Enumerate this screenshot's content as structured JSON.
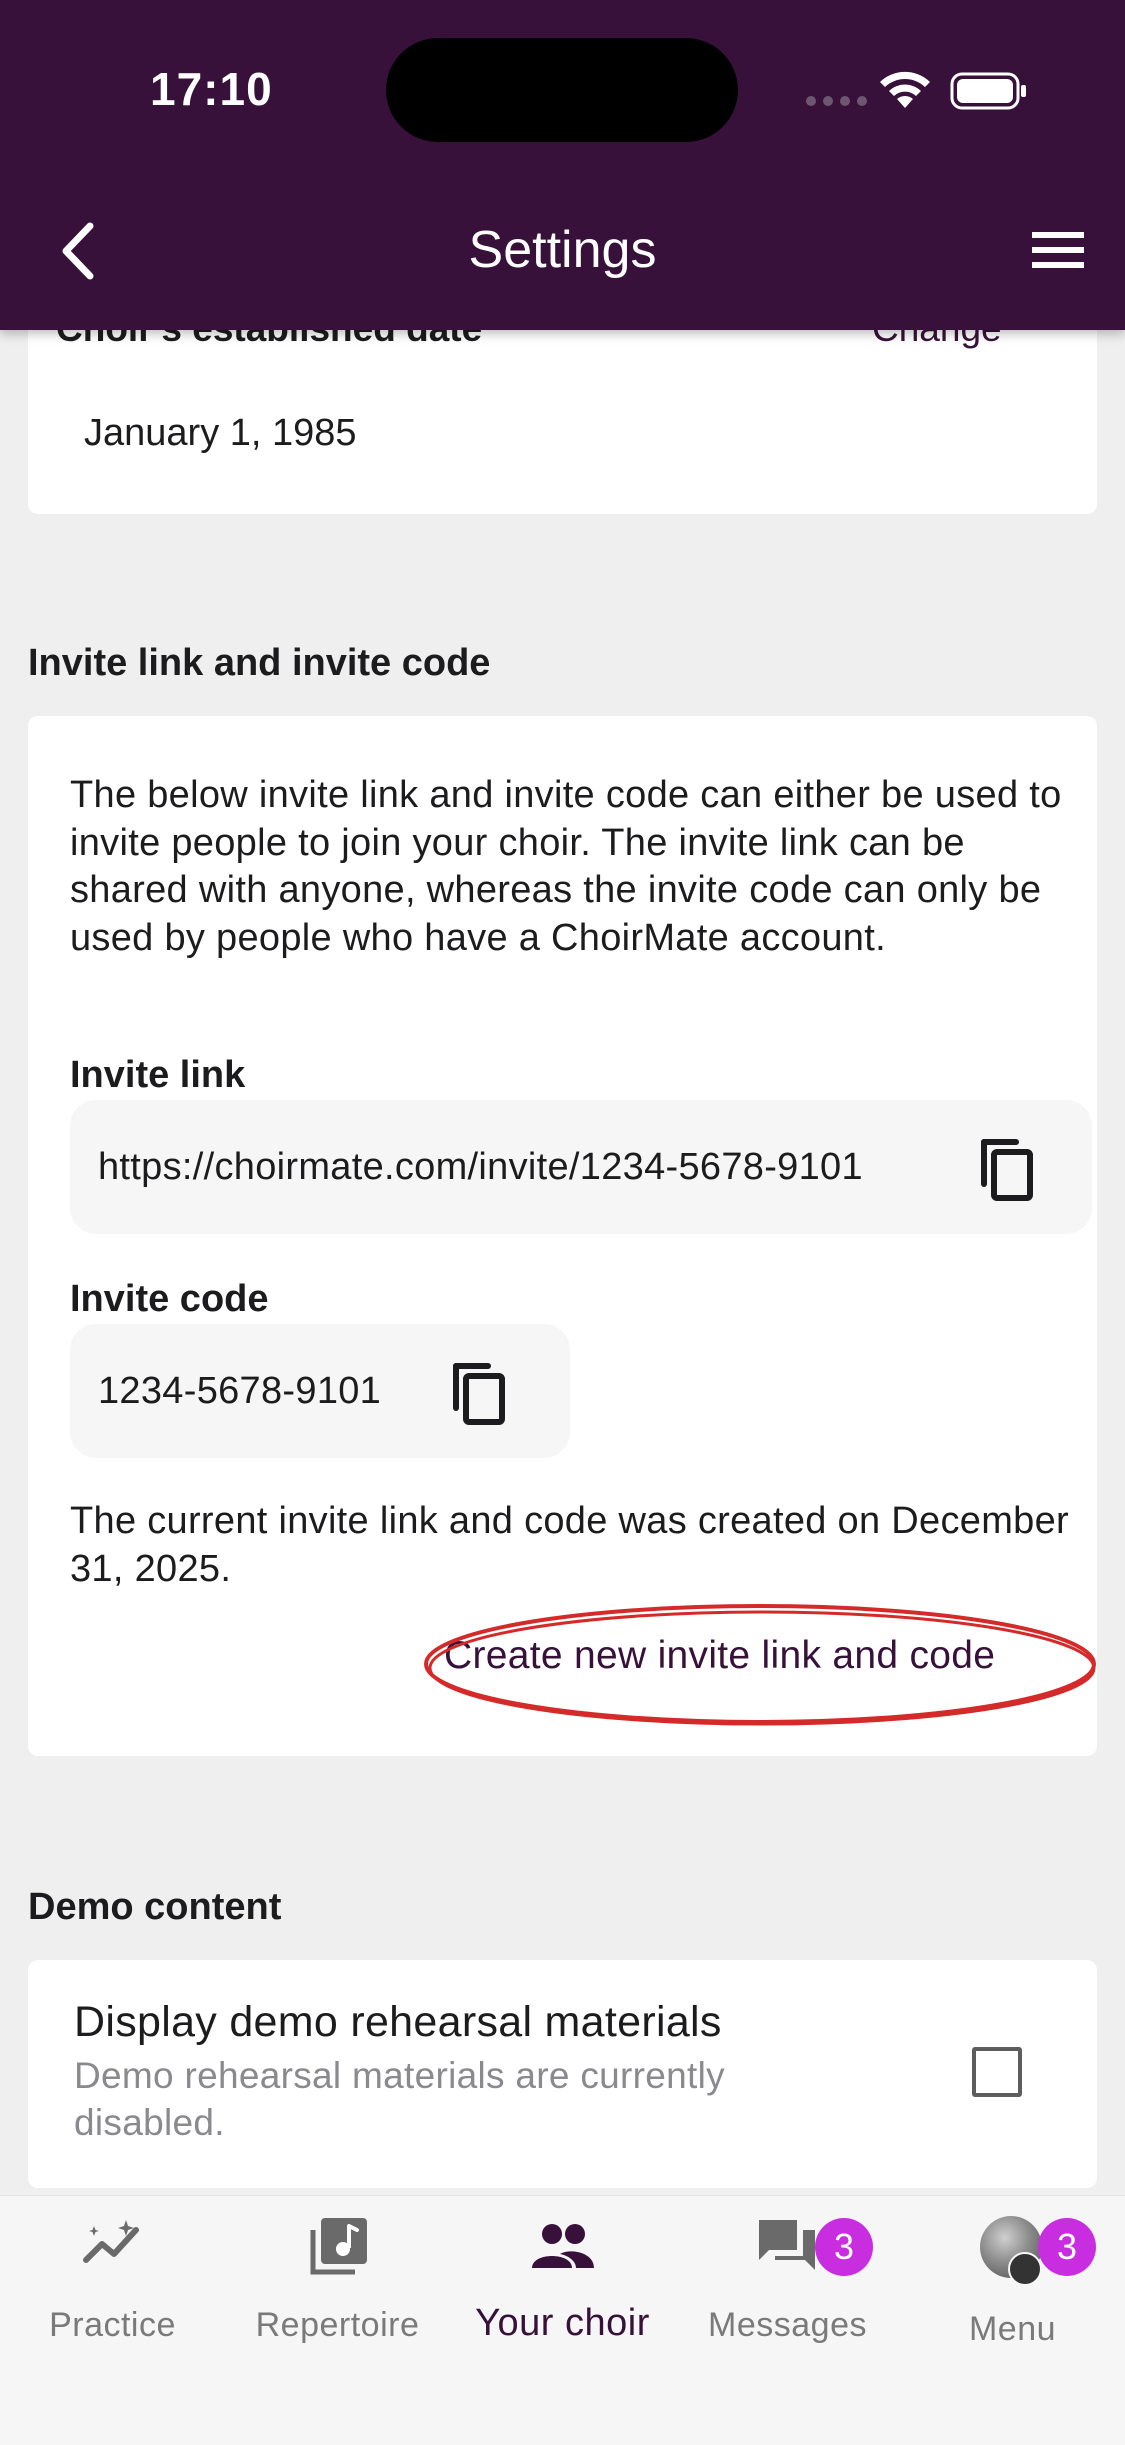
{
  "status_bar": {
    "time": "17:10"
  },
  "header": {
    "title": "Settings"
  },
  "established": {
    "label": "Choir's established date",
    "change_label": "Change",
    "date": "January 1, 1985"
  },
  "invite": {
    "section_title": "Invite link and invite code",
    "description": "The below invite link and invite code can either be used to invite people to join your choir. The invite link can be shared with anyone, whereas the invite code can only be used by people who have a ChoirMate account.",
    "link_label": "Invite link",
    "link_value": "https://choirmate.com/invite/1234-5678-9101",
    "code_label": "Invite code",
    "code_value": "1234-5678-9101",
    "created_text": "The current invite link and code was created on December 31, 2025.",
    "create_new_label": "Create new invite link and code"
  },
  "demo": {
    "section_title": "Demo content",
    "title": "Display demo rehearsal materials",
    "subtitle": "Demo rehearsal materials are currently disabled.",
    "checked": false
  },
  "bottom_nav": {
    "items": [
      {
        "label": "Practice",
        "icon": "practice-icon"
      },
      {
        "label": "Repertoire",
        "icon": "repertoire-icon"
      },
      {
        "label": "Your choir",
        "icon": "people-icon",
        "active": true
      },
      {
        "label": "Messages",
        "icon": "messages-icon",
        "badge": "3"
      },
      {
        "label": "Menu",
        "icon": "avatar",
        "badge": "3"
      }
    ]
  },
  "colors": {
    "brand": "#38113a",
    "badge": "#c82de0",
    "highlight": "#d42a2a",
    "background": "#efefef"
  }
}
